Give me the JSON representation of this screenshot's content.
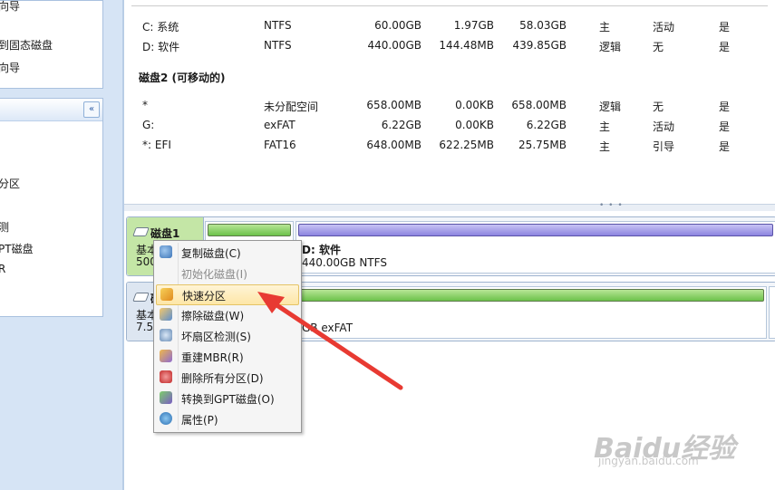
{
  "sidebar": {
    "wizard_items": [
      "向导",
      "到固态磁盘",
      "向导"
    ],
    "ops_collapse_icon": "double-chevron-up-icon",
    "ops_items": [
      "分区",
      "测",
      "PT磁盘",
      "R"
    ]
  },
  "partition_list": {
    "disk1_rows": [
      {
        "name": "C: 系统",
        "fs": "NTFS",
        "capacity": "60.00GB",
        "used": "1.97GB",
        "free": "58.03GB",
        "type": "主",
        "status": "活动",
        "extra": "是"
      },
      {
        "name": "D: 软件",
        "fs": "NTFS",
        "capacity": "440.00GB",
        "used": "144.48MB",
        "free": "439.85GB",
        "type": "逻辑",
        "status": "无",
        "extra": "是"
      }
    ],
    "disk2_title": "磁盘2 (可移动的)",
    "disk2_rows": [
      {
        "name": "*",
        "fs": "未分配空间",
        "capacity": "658.00MB",
        "used": "0.00KB",
        "free": "658.00MB",
        "type": "逻辑",
        "status": "无",
        "extra": "是"
      },
      {
        "name": "G:",
        "fs": "exFAT",
        "capacity": "6.22GB",
        "used": "0.00KB",
        "free": "6.22GB",
        "type": "主",
        "status": "活动",
        "extra": "是"
      },
      {
        "name": "*: EFI",
        "fs": "FAT16",
        "capacity": "648.00MB",
        "used": "622.25MB",
        "free": "25.75MB",
        "type": "主",
        "status": "引导",
        "extra": "是"
      }
    ],
    "splitter_dots": "• • •"
  },
  "disk_map": {
    "disk1": {
      "name": "磁盘1",
      "type": "基本",
      "size": "500",
      "part_d_title": "D: 软件",
      "part_d_info": "440.00GB NTFS"
    },
    "disk2": {
      "name": "磁",
      "type": "基本",
      "size": "7.50",
      "part_g_info": "GB exFAT"
    }
  },
  "context_menu": {
    "items": [
      {
        "label": "复制磁盘(C)",
        "icon": "copy-disk-icon",
        "enabled": true,
        "highlight": false
      },
      {
        "label": "初始化磁盘(I)",
        "icon": "",
        "enabled": false,
        "highlight": false
      },
      {
        "label": "快速分区",
        "icon": "quick-partition-icon",
        "enabled": true,
        "highlight": true
      },
      {
        "label": "擦除磁盘(W)",
        "icon": "wipe-disk-icon",
        "enabled": true,
        "highlight": false
      },
      {
        "label": "坏扇区检测(S)",
        "icon": "bad-sector-icon",
        "enabled": true,
        "highlight": false
      },
      {
        "label": "重建MBR(R)",
        "icon": "rebuild-mbr-icon",
        "enabled": true,
        "highlight": false
      },
      {
        "label": "删除所有分区(D)",
        "icon": "delete-partitions-icon",
        "enabled": true,
        "highlight": false
      },
      {
        "label": "转换到GPT磁盘(O)",
        "icon": "convert-gpt-icon",
        "enabled": true,
        "highlight": false
      },
      {
        "label": "属性(P)",
        "icon": "properties-icon",
        "enabled": true,
        "highlight": false
      }
    ]
  },
  "colors": {
    "arrow": "#e83a32",
    "disk_selected": "#c4e6a6",
    "bar_green": "#6cc24a",
    "bar_purple": "#8c84df"
  },
  "watermark": {
    "logo": "Baidu经验",
    "url": "jingyan.baidu.com"
  }
}
